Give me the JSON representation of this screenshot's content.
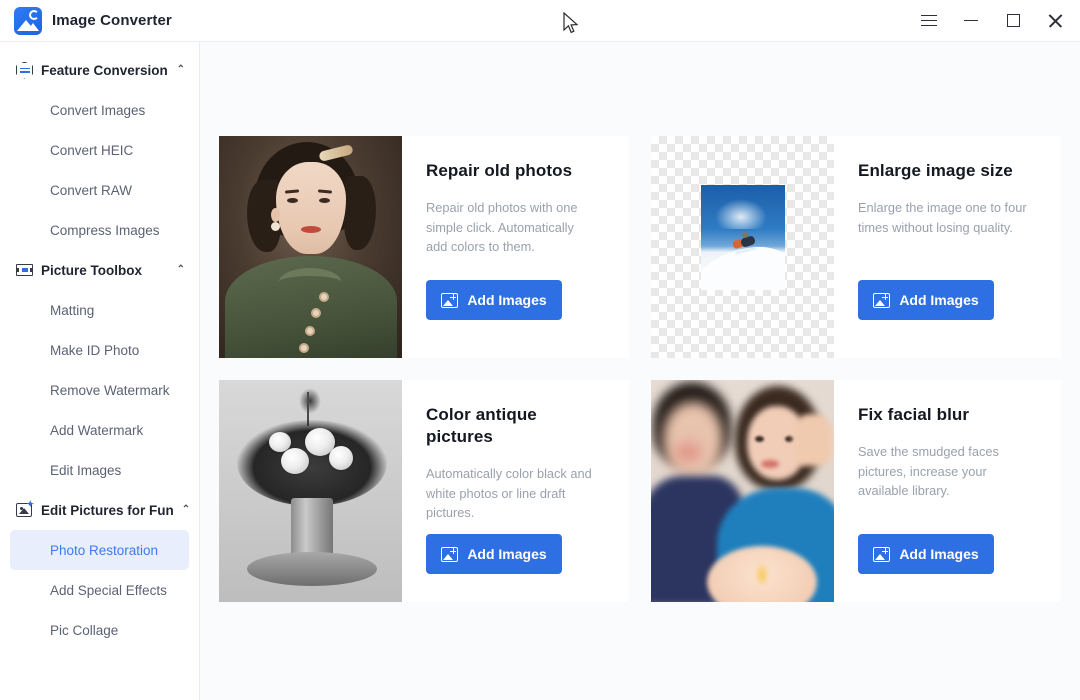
{
  "app": {
    "title": "Image Converter",
    "logo_icon": "image-converter-logo"
  },
  "titlebar": {
    "menu_label": "",
    "minimize_label": "",
    "maximize_label": "",
    "close_label": "",
    "icons": {
      "menu": "hamburger-menu-icon",
      "minimize": "minimize-icon",
      "maximize": "maximize-icon",
      "close": "close-icon"
    }
  },
  "sidebar": {
    "groups": [
      {
        "label": "Feature Conversion",
        "icon": "convert-hexagon-icon",
        "chevron": "⌃",
        "expanded": true,
        "items": [
          {
            "label": "Convert Images",
            "selected": false
          },
          {
            "label": "Convert HEIC",
            "selected": false
          },
          {
            "label": "Convert RAW",
            "selected": false
          },
          {
            "label": "Compress Images",
            "selected": false
          }
        ]
      },
      {
        "label": "Picture Toolbox",
        "icon": "toolbox-icon",
        "chevron": "⌃",
        "expanded": true,
        "items": [
          {
            "label": "Matting",
            "selected": false
          },
          {
            "label": "Make ID Photo",
            "selected": false
          },
          {
            "label": "Remove Watermark",
            "selected": false
          },
          {
            "label": "Add Watermark",
            "selected": false
          },
          {
            "label": "Edit Images",
            "selected": false
          }
        ]
      },
      {
        "label": "Edit Pictures for Fun",
        "icon": "fun-picture-icon",
        "chevron": "⌃",
        "expanded": true,
        "items": [
          {
            "label": "Photo Restoration",
            "selected": true
          },
          {
            "label": "Add Special Effects",
            "selected": false
          },
          {
            "label": "Pic Collage",
            "selected": false
          }
        ]
      }
    ]
  },
  "main": {
    "cards": [
      {
        "title": "Repair old photos",
        "description": "Repair old photos with one simple click. Automatically add colors to them.",
        "button_label": "Add Images",
        "button_icon": "add-image-icon",
        "media": "vintage-portrait-photo"
      },
      {
        "title": "Enlarge image size",
        "description": "Enlarge the image one to four times without losing quality.",
        "button_label": "Add Images",
        "button_icon": "add-image-icon",
        "media": "snowboarder-photo-on-transparent-checkerboard"
      },
      {
        "title": "Color antique pictures",
        "description": "Automatically color black and white photos or line draft pictures.",
        "button_label": "Add Images",
        "button_icon": "add-image-icon",
        "media": "black-and-white-flower-bouquet-photo"
      },
      {
        "title": "Fix facial blur",
        "description": "Save the smudged faces pictures, increase your available library.",
        "button_label": "Add Images",
        "button_icon": "add-image-icon",
        "media": "blurred-faces-selfie-photo"
      }
    ]
  },
  "colors": {
    "accent": "#2f6fe4",
    "selected_nav_bg": "#e8eefc",
    "selected_nav_text": "#3b7cf0",
    "content_bg": "#fafbfd",
    "card_bg": "#ffffff",
    "title_text": "#141820",
    "muted_text": "#9aa1ad"
  }
}
